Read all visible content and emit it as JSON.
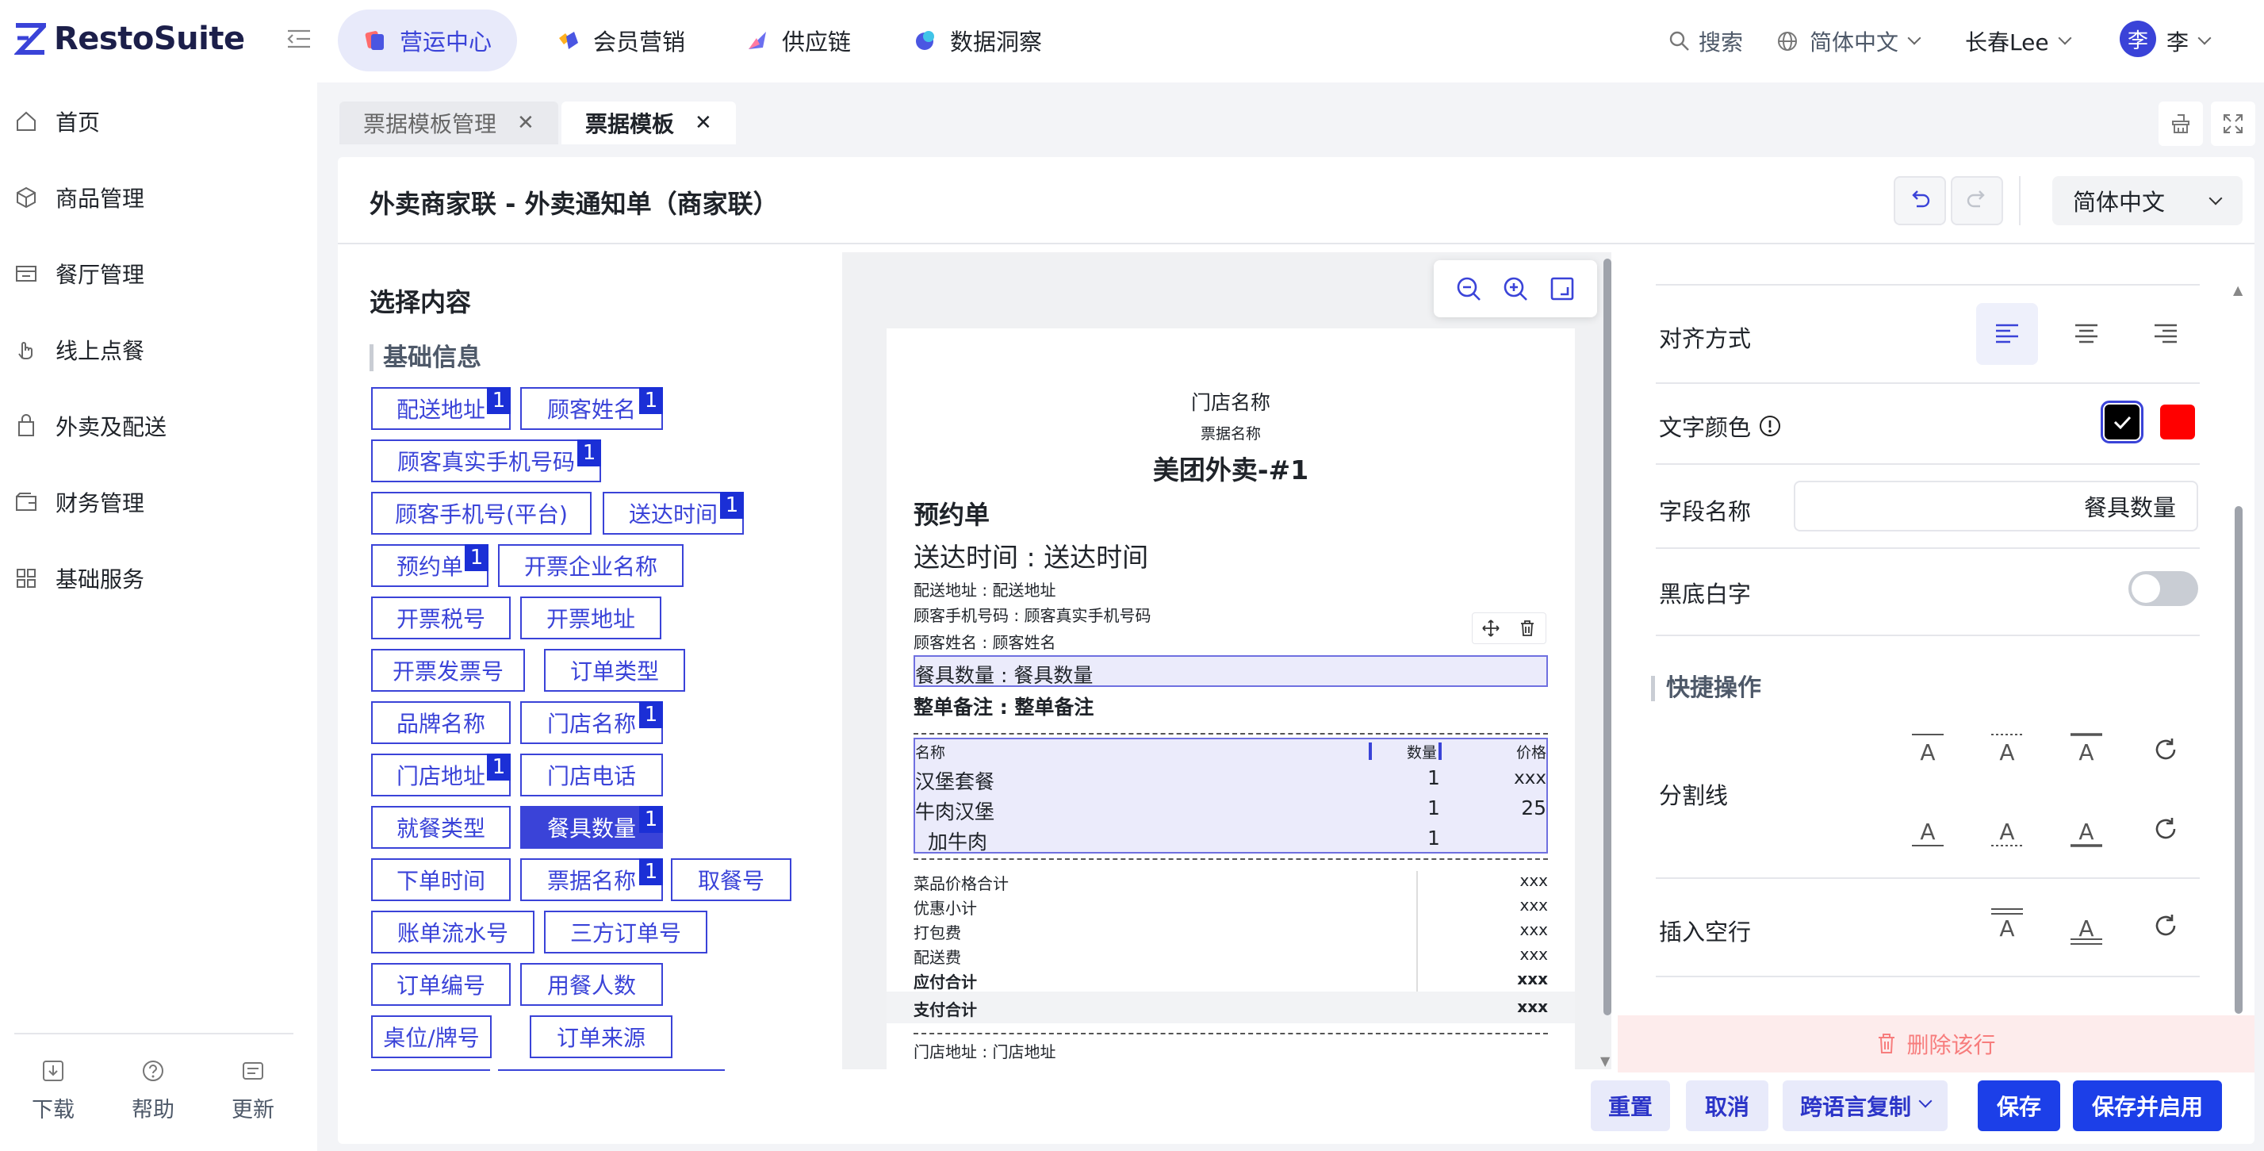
{
  "app": {
    "brand": "RestoSuite"
  },
  "nav": {
    "tabs": [
      {
        "label": "营运中心",
        "icon": "operations-icon"
      },
      {
        "label": "会员营销",
        "icon": "member-icon"
      },
      {
        "label": "供应链",
        "icon": "supply-chain-icon"
      },
      {
        "label": "数据洞察",
        "icon": "data-insight-icon"
      }
    ],
    "search": "搜索",
    "language": "简体中文",
    "store": "长春Lee",
    "avatar_char": "李",
    "user": "李"
  },
  "sidebar": {
    "items": [
      {
        "label": "首页",
        "icon": "home-icon"
      },
      {
        "label": "商品管理",
        "icon": "box-icon"
      },
      {
        "label": "餐厅管理",
        "icon": "store-icon"
      },
      {
        "label": "线上点餐",
        "icon": "hand-icon"
      },
      {
        "label": "外卖及配送",
        "icon": "bag-icon"
      },
      {
        "label": "财务管理",
        "icon": "wallet-icon"
      },
      {
        "label": "基础服务",
        "icon": "grid-icon"
      }
    ],
    "bottom": [
      {
        "label": "下载",
        "icon": "download-icon"
      },
      {
        "label": "帮助",
        "icon": "help-icon"
      },
      {
        "label": "更新",
        "icon": "update-icon"
      }
    ]
  },
  "page_tabs": [
    {
      "label": "票据模板管理",
      "active": false
    },
    {
      "label": "票据模板",
      "active": true
    }
  ],
  "editor": {
    "title": "外卖商家联 - 外卖通知单（商家联）",
    "language": "简体中文"
  },
  "content_panel": {
    "title": "选择内容",
    "section": "基础信息",
    "chips": [
      {
        "label": "配送地址",
        "badge": "1"
      },
      {
        "label": "顾客姓名",
        "badge": "1"
      },
      {
        "label": "顾客真实手机号码",
        "badge": "1"
      },
      {
        "label": "顾客手机号(平台)",
        "badge": ""
      },
      {
        "label": "送达时间",
        "badge": "1"
      },
      {
        "label": "预约单",
        "badge": "1"
      },
      {
        "label": "开票企业名称",
        "badge": ""
      },
      {
        "label": "开票税号",
        "badge": ""
      },
      {
        "label": "开票地址",
        "badge": ""
      },
      {
        "label": "开票发票号",
        "badge": ""
      },
      {
        "label": "订单类型",
        "badge": ""
      },
      {
        "label": "品牌名称",
        "badge": ""
      },
      {
        "label": "门店名称",
        "badge": "1"
      },
      {
        "label": "门店地址",
        "badge": "1"
      },
      {
        "label": "门店电话",
        "badge": ""
      },
      {
        "label": "就餐类型",
        "badge": ""
      },
      {
        "label": "餐具数量",
        "badge": "1",
        "selected": true
      },
      {
        "label": "下单时间",
        "badge": ""
      },
      {
        "label": "票据名称",
        "badge": "1"
      },
      {
        "label": "取餐号",
        "badge": ""
      },
      {
        "label": "账单流水号",
        "badge": ""
      },
      {
        "label": "三方订单号",
        "badge": ""
      },
      {
        "label": "订单编号",
        "badge": ""
      },
      {
        "label": "用餐人数",
        "badge": ""
      },
      {
        "label": "桌位/牌号",
        "badge": ""
      },
      {
        "label": "订单来源",
        "badge": ""
      }
    ]
  },
  "receipt": {
    "store_name": "门店名称",
    "receipt_name": "票据名称",
    "platform": "美团外卖-#1",
    "reservation": "预约单",
    "delivery_time": "送达时间 : 送达时间",
    "address": "配送地址 : 配送地址",
    "phone": "顾客手机号码 : 顾客真实手机号码",
    "customer": "顾客姓名 : 顾客姓名",
    "tableware": "餐具数量 : 餐具数量",
    "remark": "整单备注 : 整单备注",
    "table_headers": {
      "name": "名称",
      "qty": "数量",
      "price": "价格"
    },
    "items": [
      {
        "name": "汉堡套餐",
        "qty": "1",
        "price": "xxx"
      },
      {
        "name": "牛肉汉堡",
        "qty": "1",
        "price": "25"
      },
      {
        "name": "加牛肉",
        "qty": "1",
        "price": ""
      }
    ],
    "totals": [
      {
        "label": "菜品价格合计",
        "value": "xxx",
        "bold": false
      },
      {
        "label": "优惠小计",
        "value": "xxx",
        "bold": false
      },
      {
        "label": "打包费",
        "value": "xxx",
        "bold": false
      },
      {
        "label": "配送费",
        "value": "xxx",
        "bold": false
      },
      {
        "label": "应付合计",
        "value": "xxx",
        "bold": true
      },
      {
        "label": "支付合计",
        "value": "xxx",
        "bold": true
      }
    ],
    "store_address": "门店地址 : 门店地址"
  },
  "props": {
    "align_label": "对齐方式",
    "color_label": "文字颜色",
    "colors": [
      "#000000",
      "#ff0000"
    ],
    "field_name_label": "字段名称",
    "field_name_value": "餐具数量",
    "invert_label": "黑底白字",
    "quick_title": "快捷操作",
    "divider_label": "分割线",
    "blank_label": "插入空行",
    "glyph": "A",
    "delete_row": "删除该行"
  },
  "footer": {
    "reset": "重置",
    "cancel": "取消",
    "copy_lang": "跨语言复制",
    "save": "保存",
    "save_enable": "保存并启用"
  }
}
